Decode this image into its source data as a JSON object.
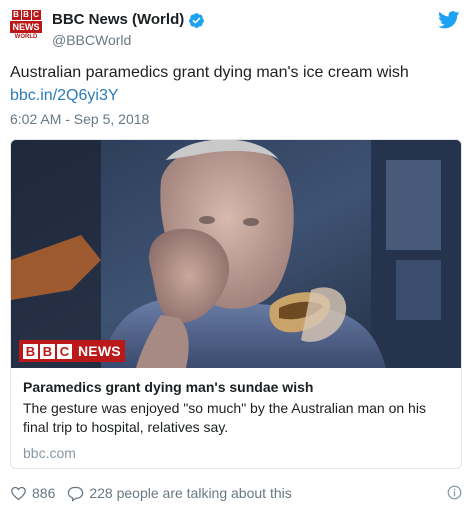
{
  "account": {
    "display_name": "BBC News (World)",
    "handle": "@BBCWorld",
    "avatar_text": {
      "b1": "B",
      "b2": "B",
      "b3": "C",
      "news": "NEWS",
      "world": "WORLD"
    },
    "verified": true
  },
  "tweet": {
    "text": "Australian paramedics grant dying man's ice cream wish",
    "link": "bbc.in/2Q6yi3Y",
    "timestamp": "6:02 AM - Sep 5, 2018"
  },
  "card": {
    "badge": {
      "b1": "B",
      "b2": "B",
      "b3": "C",
      "text": "NEWS"
    },
    "title": "Paramedics grant dying man's sundae wish",
    "description": "The gesture was enjoyed \"so much\" by the Australian man on his final trip to hospital, relatives say.",
    "domain": "bbc.com"
  },
  "actions": {
    "likes": "886",
    "conversation": "228 people are talking about this"
  },
  "icons": [
    "bbc-news-avatar",
    "verified-badge-icon",
    "twitter-bird-icon",
    "heart-icon",
    "comment-icon",
    "info-icon"
  ],
  "colors": {
    "brand_red": "#bb1919",
    "link": "#2b7bb9",
    "twitter_blue": "#1da1f2",
    "muted": "#697882"
  }
}
